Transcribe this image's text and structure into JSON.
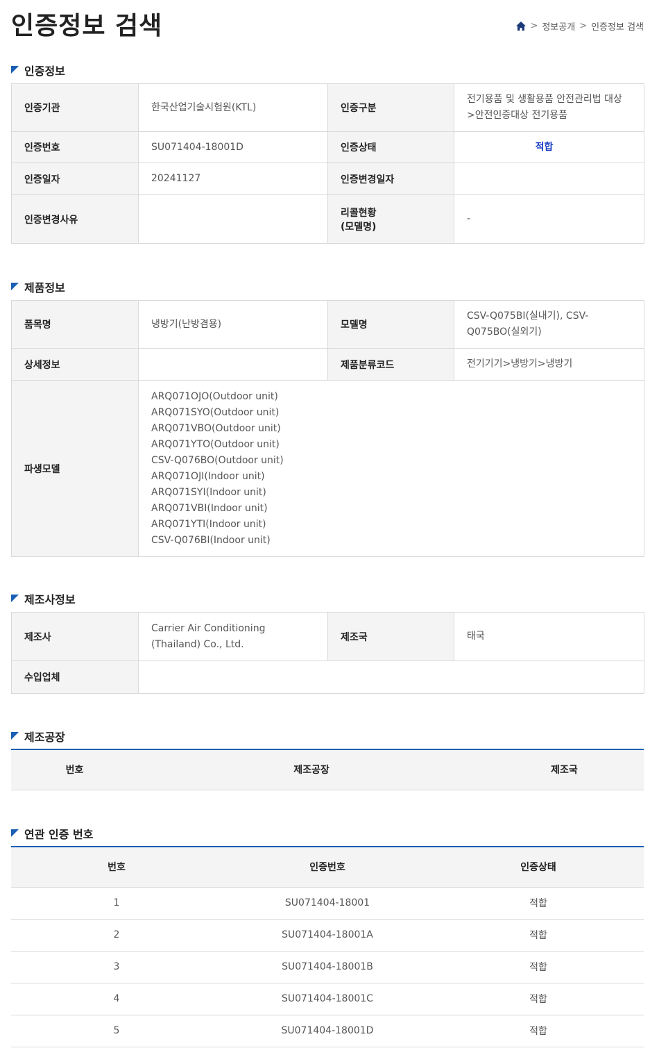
{
  "page": {
    "title": "인증정보 검색"
  },
  "breadcrumb": {
    "home_icon": "home-icon",
    "items": [
      "정보공개",
      "인증정보 검색"
    ],
    "separator": ">"
  },
  "colors": {
    "accent": "#1a5fb4",
    "status_ok": "#1a3fc4"
  },
  "cert_section": {
    "title": "인증정보",
    "agency_label": "인증기관",
    "agency_value": "한국산업기술시험원(KTL)",
    "category_label": "인증구분",
    "category_value_1": "전기용품 및 생활용품 안전관리법 대상",
    "category_value_2": ">안전인증대상 전기용품",
    "number_label": "인증번호",
    "number_value": "SU071404-18001D",
    "status_label": "인증상태",
    "status_value": "적합",
    "date_label": "인증일자",
    "date_value": "20241127",
    "change_date_label": "인증변경일자",
    "change_date_value": "",
    "change_reason_label": "인증변경사유",
    "change_reason_value": "",
    "recall_label_1": "리콜현황",
    "recall_label_2": "(모델명)",
    "recall_value": "-"
  },
  "product_section": {
    "title": "제품정보",
    "item_label": "품목명",
    "item_value": "냉방기(난방겸용)",
    "model_label": "모델명",
    "model_value_1": "CSV-Q075BI(실내기), CSV-",
    "model_value_2": "Q075BO(실외기)",
    "detail_label": "상세정보",
    "detail_value": "",
    "class_label": "제품분류코드",
    "class_value": "전기기기>냉방기>냉방기",
    "derived_label": "파생모델",
    "derived_models": [
      "ARQ071OJO(Outdoor unit)",
      "ARQ071SYO(Outdoor unit)",
      "ARQ071VBO(Outdoor unit)",
      "ARQ071YTO(Outdoor unit)",
      "CSV-Q076BO(Outdoor unit)",
      "ARQ071OJI(Indoor unit)",
      "ARQ071SYI(Indoor unit)",
      "ARQ071VBI(Indoor unit)",
      "ARQ071YTI(Indoor unit)",
      "CSV-Q076BI(Indoor unit)"
    ]
  },
  "maker_section": {
    "title": "제조사정보",
    "maker_label": "제조사",
    "maker_value_1": "Carrier Air Conditioning",
    "maker_value_2": "(Thailand) Co., Ltd.",
    "country_label": "제조국",
    "country_value": "태국",
    "importer_label": "수입업체",
    "importer_value": ""
  },
  "factory_section": {
    "title": "제조공장",
    "headers": [
      "번호",
      "제조공장",
      "제조국"
    ]
  },
  "related_section": {
    "title": "연관 인증 번호",
    "headers": [
      "번호",
      "인증번호",
      "인증상태"
    ],
    "rows": [
      [
        "1",
        "SU071404-18001",
        "적합"
      ],
      [
        "2",
        "SU071404-18001A",
        "적합"
      ],
      [
        "3",
        "SU071404-18001B",
        "적합"
      ],
      [
        "4",
        "SU071404-18001C",
        "적합"
      ],
      [
        "5",
        "SU071404-18001D",
        "적합"
      ]
    ]
  }
}
